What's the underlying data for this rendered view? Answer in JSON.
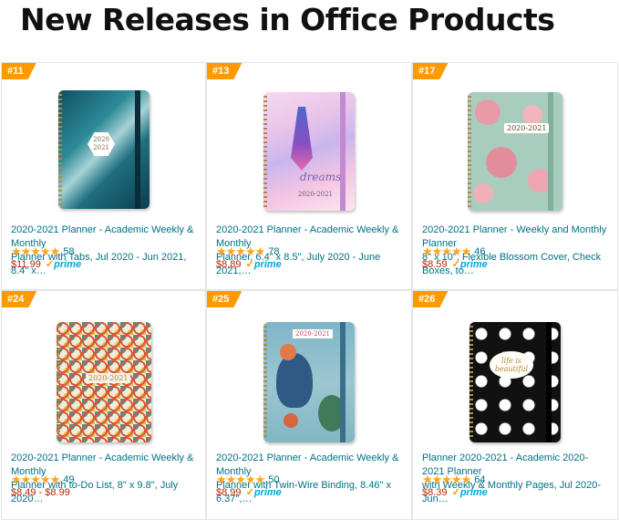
{
  "page": {
    "title": "New Releases in Office Products"
  },
  "products": [
    {
      "rank": "#11",
      "title_line1": "2020-2021 Planner - Academic Weekly & Monthly",
      "title_line2": "Planner with Tabs, Jul 2020 - Jun 2021, 8.4\" x…",
      "stars": "★★★★★",
      "rating_count": "58",
      "price": "$11.99",
      "prime": "prime",
      "cover_text": "2020\n2021",
      "rating": 4.5
    },
    {
      "rank": "#13",
      "title_line1": "2020-2021 Planner - Academic Weekly & Monthly",
      "title_line2": "Planner, 6.4\" x 8.5\", July 2020 - June 2021,…",
      "stars": "★★★★★",
      "rating_count": "78",
      "price": "$8.89",
      "prime": "prime",
      "cover_text": "dreams",
      "cover_sub": "2020-2021",
      "rating": 5
    },
    {
      "rank": "#17",
      "title_line1": "2020-2021 Planner - Weekly and Monthly Planner",
      "title_line2": "8\" x 10\", Flexible Blossom Cover, Check Boxes, to…",
      "stars": "★★★★★",
      "rating_count": "46",
      "price": "$8.59",
      "prime": "prime",
      "cover_text": "2020-2021",
      "rating": 4.5
    },
    {
      "rank": "#24",
      "title_line1": "2020-2021 Planner - Academic Weekly & Monthly",
      "title_line2": "Planner with to-Do List, 8\" x 9.8\", July 2020…",
      "stars": "★★★★★",
      "rating_count": "49",
      "price": "$8.49 - $8.99",
      "prime": "",
      "cover_text": "2020-2021",
      "rating": 5
    },
    {
      "rank": "#25",
      "title_line1": "2020-2021 Planner - Academic Weekly & Monthly",
      "title_line2": "Planner with Twin-Wire Binding, 8.46\" x 6.37\",…",
      "stars": "★★★★★",
      "rating_count": "50",
      "price": "$8.99",
      "prime": "prime",
      "cover_text": "2020-2021",
      "rating": 5
    },
    {
      "rank": "#26",
      "title_line1": "Planner 2020-2021 - Academic 2020-2021 Planner",
      "title_line2": "with Weekly & Monthly Pages, Jul 2020-Jun…",
      "stars": "★★★★★",
      "rating_count": "64",
      "price": "$8.39",
      "prime": "prime",
      "cover_text": "life is beautiful",
      "rating": 5
    }
  ],
  "colors": {
    "rank_badge": "#ff9900",
    "link": "#007185",
    "price": "#b12704",
    "star": "#ffa41c",
    "prime": "#00a8e1"
  }
}
